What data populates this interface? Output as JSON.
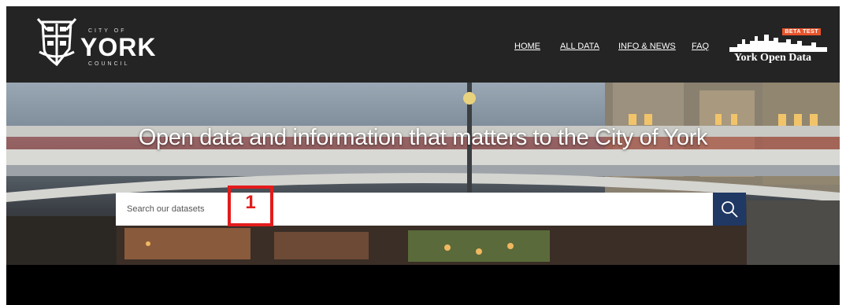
{
  "logo": {
    "city_of": "CITY OF",
    "name": "YORK",
    "council": "COUNCIL"
  },
  "nav": {
    "items": [
      {
        "label": "HOME"
      },
      {
        "label": "ALL DATA"
      },
      {
        "label": "INFO & NEWS"
      },
      {
        "label": "FAQ"
      }
    ]
  },
  "brand": {
    "badge": "BETA TEST",
    "name": "York Open Data"
  },
  "hero": {
    "headline": "Open data and information that matters to the City of York"
  },
  "search": {
    "placeholder": "Search our datasets",
    "value": ""
  },
  "annotation": {
    "label": "1",
    "color": "#e31b1b"
  },
  "icons": {
    "search_button": "search-icon",
    "crest": "coat-of-arms-icon",
    "skyline": "york-skyline-icon"
  },
  "colors": {
    "header_bg": "#242424",
    "search_button_bg": "#1f3864",
    "beta_badge": "#e8542c"
  }
}
